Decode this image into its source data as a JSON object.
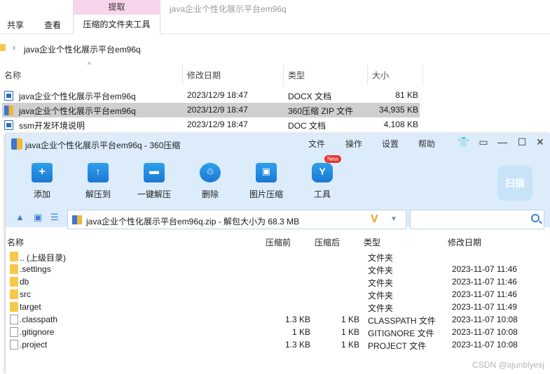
{
  "ribbon": {
    "tabs": [
      "共享",
      "查看"
    ],
    "context_head": "提取",
    "context_tab": "压缩的文件夹工具",
    "window_title": "java企业个性化展示平台em96q"
  },
  "address": {
    "path": "java企业个性化展示平台em96q"
  },
  "explorer": {
    "columns": [
      "名称",
      "修改日期",
      "类型",
      "大小"
    ],
    "rows": [
      {
        "name": "java企业个性化展示平台em96q",
        "date": "2023/12/9 18:47",
        "type": "DOCX 文档",
        "size": "81 KB",
        "icon": "docx-icon",
        "selected": false
      },
      {
        "name": "java企业个性化展示平台em96q",
        "date": "2023/12/9 18:47",
        "type": "360压缩 ZIP 文件",
        "size": "34,935 KB",
        "icon": "zip-icon",
        "selected": true
      },
      {
        "name": "ssm开发环境说明",
        "date": "2023/12/9 18:47",
        "type": "DOC 文档",
        "size": "4,108 KB",
        "icon": "doc-icon",
        "selected": false
      }
    ]
  },
  "zip": {
    "title": "java企业个性化展示平台em96q - 360压缩",
    "menu": [
      "文件",
      "操作",
      "设置",
      "帮助"
    ],
    "tools": [
      {
        "label": "添加",
        "icon": "add-icon"
      },
      {
        "label": "解压到",
        "icon": "extract-to-icon"
      },
      {
        "label": "一键解压",
        "icon": "one-click-extract-icon"
      },
      {
        "label": "删除",
        "icon": "delete-icon"
      },
      {
        "label": "图片压缩",
        "icon": "image-compress-icon"
      },
      {
        "label": "工具",
        "icon": "tools-icon"
      }
    ],
    "new_badge": "New",
    "scan_label": "扫描",
    "path_text": "java企业个性化展示平台em96q.zip - 解包大小为 68.3 MB",
    "columns": [
      "名称",
      "压缩前",
      "压缩后",
      "类型",
      "修改日期"
    ],
    "rows": [
      {
        "name": ".. (上级目录)",
        "before": "",
        "after": "",
        "type": "文件夹",
        "date": "",
        "kind": "folder"
      },
      {
        "name": ".settings",
        "before": "",
        "after": "",
        "type": "文件夹",
        "date": "2023-11-07 11:46",
        "kind": "folder"
      },
      {
        "name": "db",
        "before": "",
        "after": "",
        "type": "文件夹",
        "date": "2023-11-07 11:46",
        "kind": "folder"
      },
      {
        "name": "src",
        "before": "",
        "after": "",
        "type": "文件夹",
        "date": "2023-11-07 11:46",
        "kind": "folder"
      },
      {
        "name": "target",
        "before": "",
        "after": "",
        "type": "文件夹",
        "date": "2023-11-07 11:49",
        "kind": "folder"
      },
      {
        "name": ".classpath",
        "before": "1.3 KB",
        "after": "1 KB",
        "type": "CLASSPATH 文件",
        "date": "2023-11-07 10:08",
        "kind": "file"
      },
      {
        "name": ".gitignore",
        "before": "1 KB",
        "after": "1 KB",
        "type": "GITIGNORE 文件",
        "date": "2023-11-07 10:08",
        "kind": "file"
      },
      {
        "name": ".project",
        "before": "1.3 KB",
        "after": "1 KB",
        "type": "PROJECT 文件",
        "date": "2023-11-07 10:08",
        "kind": "file"
      }
    ]
  },
  "watermark": "CSDN @ajunblyesj"
}
